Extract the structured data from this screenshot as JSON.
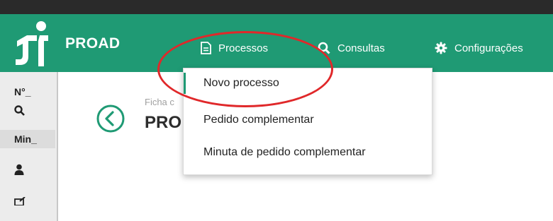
{
  "brand": {
    "name": "PROAD"
  },
  "nav": {
    "processos": "Processos",
    "consultas": "Consultas",
    "configuracoes": "Configurações"
  },
  "dropdown": {
    "items": [
      "Novo processo",
      "Pedido complementar",
      "Minuta de pedido complementar"
    ]
  },
  "sidebar": {
    "number_label": "N°_",
    "minimized_label": "Min_"
  },
  "page": {
    "subtitle": "Ficha c",
    "title": "PRO"
  },
  "colors": {
    "nav_green": "#1f9a74",
    "highlight_red": "#e0282a"
  }
}
